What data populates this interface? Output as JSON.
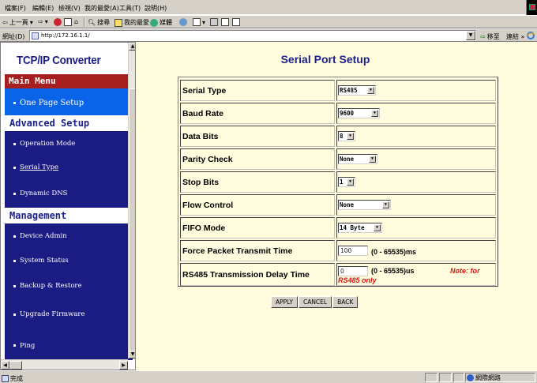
{
  "browser": {
    "menus": [
      "檔案(F)",
      "編輯(E)",
      "檢視(V)",
      "我的最愛(A)",
      "工具(T)",
      "說明(H)"
    ],
    "toolbar": {
      "back": "上一頁",
      "search": "搜尋",
      "favorites": "我的最愛",
      "media": "媒體"
    },
    "address_label": "網址(D)",
    "address": "http://172.16.1.1/",
    "go_label": "移至",
    "links_label": "連結",
    "status_text": "完成",
    "zone_text": "網際網路"
  },
  "sidebar": {
    "title": "TCP/IP Converter",
    "main_menu": "Main Menu",
    "items_main": [
      {
        "label": "One Page Setup"
      }
    ],
    "advanced_header": "Advanced Setup",
    "items_advanced": [
      {
        "label": "Operation Mode"
      },
      {
        "label": "Serial Type"
      },
      {
        "label": "Dynamic DNS"
      }
    ],
    "management_header": "Management",
    "items_management": [
      {
        "label": "Device Admin"
      },
      {
        "label": "System Status"
      },
      {
        "label": "Backup & Restore"
      },
      {
        "label": "Upgrade Firmware"
      },
      {
        "label": "Ping"
      }
    ]
  },
  "main": {
    "title": "Serial Port Setup",
    "fields": {
      "serial_type": {
        "label": "Serial Type",
        "value": "RS485"
      },
      "baud_rate": {
        "label": "Baud Rate",
        "value": "9600"
      },
      "data_bits": {
        "label": "Data Bits",
        "value": "8"
      },
      "parity_check": {
        "label": "Parity Check",
        "value": "None"
      },
      "stop_bits": {
        "label": "Stop Bits",
        "value": "1"
      },
      "flow_control": {
        "label": "Flow Control",
        "value": "None"
      },
      "fifo_mode": {
        "label": "FIFO Mode",
        "value": "14 Byte"
      },
      "force_packet": {
        "label": "Force Packet Transmit Time",
        "value": "100",
        "range": "(0 - 65535)ms"
      },
      "rs485_delay": {
        "label": "RS485 Transmission Delay Time",
        "value": "0",
        "range": "(0 - 65535)us",
        "note": "Note: for",
        "note2": "RS485 only"
      }
    },
    "buttons": {
      "apply": "APPLY",
      "cancel": "CANCEL",
      "back": "BACK"
    }
  },
  "colors": {
    "nav_bg": "#1b1b84",
    "nav_active": "#0a64e8",
    "main_menu_bg": "#a61e1e",
    "title_blue": "#1b1f8a",
    "content_bg": "#fffdde",
    "note_red": "#e01010"
  }
}
